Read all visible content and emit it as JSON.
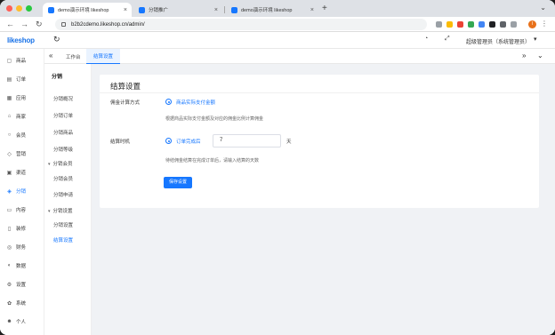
{
  "browser": {
    "tabs": [
      {
        "label": "demo演示环境 likeshop",
        "active": true
      },
      {
        "label": "分销推广",
        "active": false
      },
      {
        "label": "demo演示环境 likeshop",
        "active": false
      }
    ],
    "url": "b2b2cdemo.likeshop.cn/admin/",
    "profile_initial": "I"
  },
  "topbar": {
    "logo": "likeshop",
    "admin_label": "超级管理员（系统管理员）"
  },
  "sidebar": {
    "items": [
      {
        "label": "商品",
        "icon": "bag-icon"
      },
      {
        "label": "订单",
        "icon": "doc-icon"
      },
      {
        "label": "应用",
        "icon": "grid-icon"
      },
      {
        "label": "商家",
        "icon": "shop-icon"
      },
      {
        "label": "会员",
        "icon": "user-icon"
      },
      {
        "label": "营销",
        "icon": "gift-icon"
      },
      {
        "label": "渠道",
        "icon": "channel-icon"
      },
      {
        "label": "分销",
        "icon": "share-icon",
        "active": true
      },
      {
        "label": "内容",
        "icon": "content-icon"
      },
      {
        "label": "装修",
        "icon": "decorate-icon"
      },
      {
        "label": "财务",
        "icon": "wallet-icon"
      },
      {
        "label": "数据",
        "icon": "chart-icon"
      },
      {
        "label": "设置",
        "icon": "gear-icon"
      },
      {
        "label": "系统",
        "icon": "system-icon"
      },
      {
        "label": "个人",
        "icon": "person-icon"
      }
    ]
  },
  "subnav": {
    "heading": "分销",
    "items": [
      {
        "label": "分销概况"
      },
      {
        "label": "分销订单"
      },
      {
        "label": "分销商品"
      },
      {
        "label": "分销等级"
      },
      {
        "label": "分销会员",
        "group": true
      },
      {
        "label": "分销会员"
      },
      {
        "label": "分销申请"
      },
      {
        "label": "分销设置",
        "group": true
      },
      {
        "label": "分销设置"
      },
      {
        "label": "结算设置",
        "active": true
      }
    ]
  },
  "page_tabs": {
    "home": "工作台",
    "current": "结算设置"
  },
  "form": {
    "title": "结算设置",
    "commission_label": "佣金计算方式",
    "commission_option": "商品实际支付金额",
    "commission_hint": "根据商品实际支付金额及对应的佣金比例计算佣金",
    "settle_label": "结算时机",
    "settle_option": "订单完成后",
    "settle_days": "7",
    "settle_unit": "天",
    "settle_hint": "待结佣金结算在完成订单后，请输入结算的天数",
    "save_label": "保存设置"
  }
}
